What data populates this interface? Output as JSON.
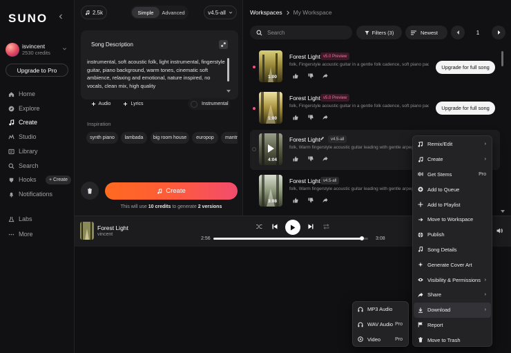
{
  "sidebar": {
    "logo": "SUNO",
    "user": {
      "name": "isvincent",
      "credits": "2530 credits"
    },
    "upgrade_label": "Upgrade to Pro",
    "nav": [
      {
        "label": "Home",
        "icon": "home-icon"
      },
      {
        "label": "Explore",
        "icon": "compass-icon"
      },
      {
        "label": "Create",
        "icon": "music-note-icon"
      },
      {
        "label": "Studio",
        "icon": "studio-icon"
      },
      {
        "label": "Library",
        "icon": "library-icon"
      },
      {
        "label": "Search",
        "icon": "search-icon"
      },
      {
        "label": "Hooks",
        "icon": "hooks-icon"
      },
      {
        "label": "Notifications",
        "icon": "bell-icon"
      },
      {
        "label": "Labs",
        "icon": "flask-icon"
      },
      {
        "label": "More",
        "icon": "more-icon"
      }
    ],
    "hooks_create": "+ Create"
  },
  "create_panel": {
    "count": "2.5k",
    "modes": [
      "Simple",
      "Advanced"
    ],
    "model": "v4.5-all",
    "description_label": "Song Description",
    "description": "instrumental, soft acoustic folk, light instrumental, fingerstyle guitar, piano background, warm tones, cinematic soft ambience, relaxing and emotional, nature inspired, no vocals, clean mix, high quality",
    "audio_label": "Audio",
    "lyrics_label": "Lyrics",
    "instrumental_label": "Instrumental",
    "inspiration_label": "Inspiration",
    "inspiration_tags": [
      "synth piano",
      "lambada",
      "big room house",
      "europop",
      "mantra"
    ],
    "create_label": "Create",
    "credits_note_prefix": "This will use ",
    "credits_note_credits": "10 credits",
    "credits_note_mid": " to generate ",
    "credits_note_versions": "2 versions"
  },
  "workspace": {
    "breadcrumb": "Workspaces",
    "current": "My Workspace",
    "search_placeholder": "Search",
    "filters_label": "Filters (3)",
    "sort_label": "Newest",
    "page": "1",
    "songs": [
      {
        "title": "Forest Light",
        "version": "v5.0 Preview",
        "desc": "folk, Fingerstyle acoustic guitar in a gentle folk cadence, soft piano pads",
        "duration": "1:00",
        "cta": "Upgrade for full song"
      },
      {
        "title": "Forest Light",
        "version": "v5.0 Preview",
        "desc": "folk, Fingerstyle acoustic guitar in a gentle folk cadence, soft piano pads",
        "duration": "1:00",
        "cta": "Upgrade for full song"
      },
      {
        "title": "Forest Light",
        "version": "v4.5-all",
        "desc": "folk, Warm fingerstyle acoustic guitar leading with gentle arpeggi",
        "duration": "4:04",
        "cta": ""
      },
      {
        "title": "Forest Light",
        "version": "v4.5-all",
        "desc": "folk, Warm fingerstyle acoustic guitar leading with gentle arpeggi",
        "duration": "3:08",
        "cta": ""
      }
    ]
  },
  "player": {
    "title": "Forest Light",
    "artist": "vincent",
    "elapsed": "2:56",
    "total": "3:08",
    "progress": 0.96
  },
  "context_menu": {
    "items": [
      {
        "label": "Remix/Edit",
        "icon": "remix-icon",
        "tail": "›"
      },
      {
        "label": "Create",
        "icon": "music-note-icon",
        "tail": "›"
      },
      {
        "label": "Get Stems",
        "icon": "stems-icon",
        "tail": "Pro"
      },
      {
        "label": "Add to Queue",
        "icon": "queue-icon",
        "tail": ""
      },
      {
        "label": "Add to Playlist",
        "icon": "plus-icon",
        "tail": ""
      },
      {
        "label": "Move to Workspace",
        "icon": "move-icon",
        "tail": ""
      },
      {
        "label": "Publish",
        "icon": "globe-icon",
        "tail": ""
      },
      {
        "label": "Song Details",
        "icon": "info-icon",
        "tail": ""
      },
      {
        "label": "Generate Cover Art",
        "icon": "sparkle-icon",
        "tail": ""
      },
      {
        "label": "Visibility & Permissions",
        "icon": "eye-icon",
        "tail": "›"
      },
      {
        "label": "Share",
        "icon": "share-icon",
        "tail": "›"
      },
      {
        "label": "Download",
        "icon": "download-icon",
        "tail": "›"
      },
      {
        "label": "Report",
        "icon": "flag-icon",
        "tail": ""
      },
      {
        "label": "Move to Trash",
        "icon": "trash-icon",
        "tail": ""
      }
    ]
  },
  "download_menu": {
    "items": [
      {
        "label": "MP3 Audio",
        "icon": "headphones-icon",
        "tail": ""
      },
      {
        "label": "WAV Audio",
        "icon": "headphones-icon",
        "tail": "Pro"
      },
      {
        "label": "Video",
        "icon": "video-icon",
        "tail": "Pro"
      }
    ]
  },
  "colors": {
    "accent_start": "#ff6a1f",
    "accent_end": "#f24c6e",
    "preview_badge": "#ff6f9c",
    "bg": "#101012"
  }
}
